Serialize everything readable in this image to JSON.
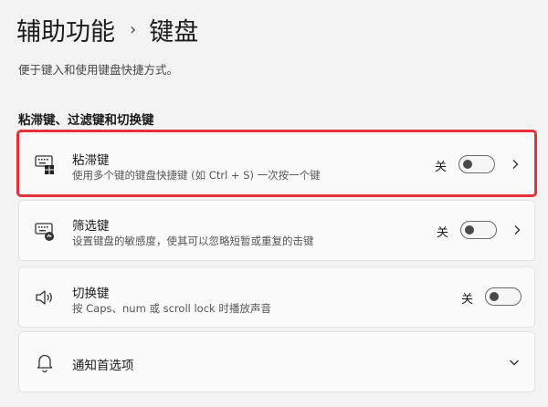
{
  "breadcrumb": {
    "parent": "辅助功能",
    "separator": "›",
    "current": "键盘"
  },
  "description": "便于键入和使用键盘快捷方式。",
  "section_title": "粘滞键、过滤键和切换键",
  "items": [
    {
      "title": "粘滞键",
      "subtitle": "使用多个键的键盘快捷键 (如 Ctrl + S) 一次按一个键",
      "state_label": "关",
      "state": "off",
      "icon": "sticky-keys-icon",
      "has_chevron": true
    },
    {
      "title": "筛选键",
      "subtitle": "设置键盘的敏感度，使其可以忽略短暂或重复的击键",
      "state_label": "关",
      "state": "off",
      "icon": "filter-keys-icon",
      "has_chevron": true
    },
    {
      "title": "切换键",
      "subtitle": "按 Caps、num 或 scroll lock 时播放声音",
      "state_label": "关",
      "state": "off",
      "icon": "speaker-icon",
      "has_chevron": false
    }
  ],
  "notifications": {
    "title": "通知首选项",
    "icon": "bell-icon",
    "expand_icon": "chevron-down-icon"
  },
  "colors": {
    "highlight_border": "#e8303a",
    "background": "#f3f3f3",
    "card": "#fbfbfb"
  }
}
